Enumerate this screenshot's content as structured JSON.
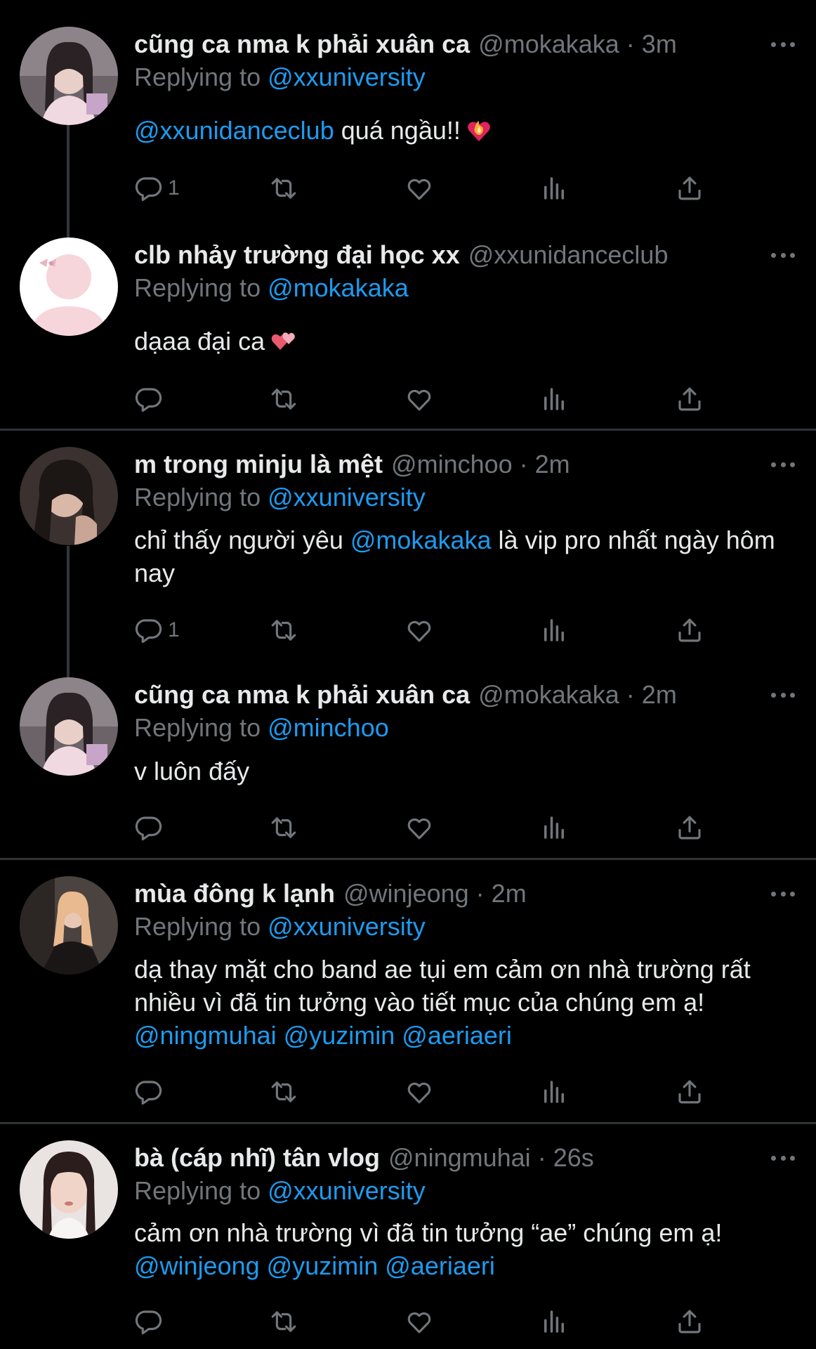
{
  "icons": {
    "more": "more-horizontal-icon",
    "reply": "reply-icon",
    "retweet": "retweet-icon",
    "like": "heart-icon",
    "views": "views-icon",
    "share": "share-icon"
  },
  "colors": {
    "background": "#000000",
    "text": "#e7e9ea",
    "muted": "#71767b",
    "link": "#1d9bf0",
    "divider": "#2f3336"
  },
  "tweets": [
    {
      "name": "cũng ca nma k phải xuân ca",
      "handle": "@mokakaka",
      "sep": "·",
      "time": "3m",
      "replying_label": "Replying to",
      "replying_to": "@xxuniversity",
      "text_segments": [
        {
          "text": "@xxunidanceclub",
          "mention": true
        },
        {
          "text": " quá ngầu!!",
          "mention": false
        }
      ],
      "emoji": "heart-on-fire-emoji",
      "reply_count": "1"
    },
    {
      "name": "clb nhảy trường đại học xx",
      "handle": "@xxunidanceclub",
      "sep": "",
      "time": "",
      "replying_label": "Replying to",
      "replying_to": "@mokakaka",
      "text_segments": [
        {
          "text": "dạaa đại ca",
          "mention": false
        }
      ],
      "emoji": "two-hearts-emoji",
      "reply_count": ""
    },
    {
      "name": "m trong minju là mệt",
      "handle": "@minchoo",
      "sep": "·",
      "time": "2m",
      "replying_label": "Replying to",
      "replying_to": "@xxuniversity",
      "text_segments": [
        {
          "text": "chỉ thấy người yêu ",
          "mention": false
        },
        {
          "text": "@mokakaka",
          "mention": true
        },
        {
          "text": " là vip pro nhất ngày hôm nay",
          "mention": false
        }
      ],
      "emoji": "",
      "reply_count": "1"
    },
    {
      "name": "cũng ca nma k phải xuân ca",
      "handle": "@mokakaka",
      "sep": "·",
      "time": "2m",
      "replying_label": "Replying to",
      "replying_to": "@minchoo",
      "text_segments": [
        {
          "text": "v luôn đấy",
          "mention": false
        }
      ],
      "emoji": "",
      "reply_count": ""
    },
    {
      "name": "mùa đông k lạnh",
      "handle": "@winjeong",
      "sep": "·",
      "time": "2m",
      "replying_label": "Replying to",
      "replying_to": "@xxuniversity",
      "text_segments": [
        {
          "text": "dạ thay mặt cho band ae tụi em cảm ơn nhà trường rất nhiều vì đã tin tưởng vào tiết mục của chúng em ạ! ",
          "mention": false
        },
        {
          "text": "@ningmuhai",
          "mention": true
        },
        {
          "text": " ",
          "mention": false
        },
        {
          "text": "@yuzimin",
          "mention": true
        },
        {
          "text": " ",
          "mention": false
        },
        {
          "text": "@aeriaeri",
          "mention": true
        }
      ],
      "emoji": "",
      "reply_count": ""
    },
    {
      "name": "bà (cáp nhĩ) tân vlog",
      "handle": "@ningmuhai",
      "sep": "·",
      "time": "26s",
      "replying_label": "Replying to",
      "replying_to": "@xxuniversity",
      "text_segments": [
        {
          "text": "cảm ơn nhà trường vì đã tin tưởng “ae” chúng em ạ! ",
          "mention": false
        },
        {
          "text": "@winjeong",
          "mention": true
        },
        {
          "text": " ",
          "mention": false
        },
        {
          "text": "@yuzimin",
          "mention": true
        },
        {
          "text": " ",
          "mention": false
        },
        {
          "text": "@aeriaeri",
          "mention": true
        }
      ],
      "emoji": "",
      "reply_count": ""
    }
  ]
}
